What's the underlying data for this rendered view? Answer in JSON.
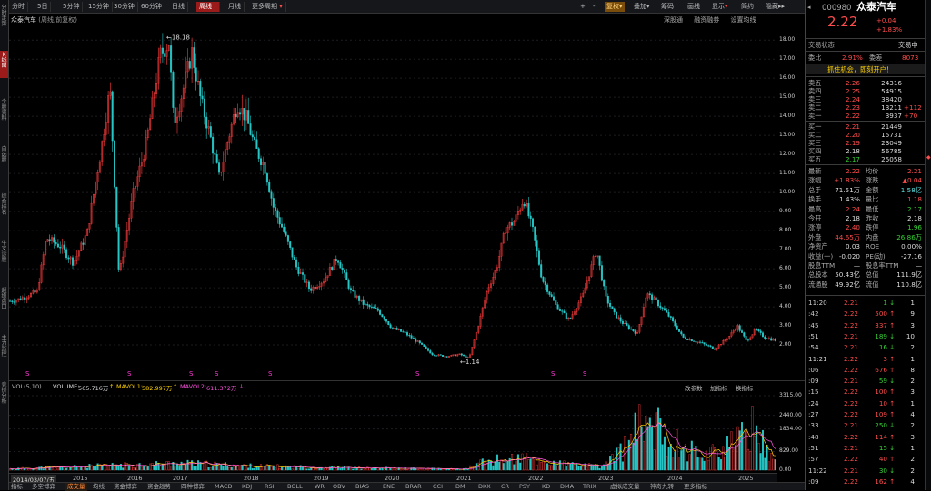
{
  "toolbar": {
    "periods": [
      "分时",
      "5日",
      "5分钟",
      "15分钟",
      "30分钟",
      "60分钟",
      "日线",
      "周线",
      "月线",
      "更多周期"
    ],
    "active_period": "周线",
    "right": [
      "+",
      "-",
      "复权",
      "叠加",
      "筹码",
      "画线",
      "显示",
      "简约",
      "隐藏"
    ]
  },
  "left_tabs": [
    "分时走势",
    "K线图",
    "个股资料",
    "自选股",
    "综合排名",
    "牛叉诊股",
    "超级盘口",
    "主力监控",
    "竞价分析"
  ],
  "chart_header": {
    "title": "众泰汽车",
    "subtitle": "(周线,前复权)",
    "links": [
      "深股通",
      "融资融券",
      "设置均线"
    ]
  },
  "chart_data": {
    "type": "candlestick",
    "price_axis": [
      "18.00",
      "17.00",
      "16.00",
      "15.00",
      "14.00",
      "13.00",
      "12.00",
      "11.00",
      "10.00",
      "9.00",
      "8.00",
      "7.00",
      "6.00",
      "5.00",
      "4.00",
      "3.00",
      "2.00"
    ],
    "high_label": "18.18",
    "low_label": "1.14",
    "years": [
      "2015",
      "2016",
      "2017",
      "2018",
      "2019",
      "2020",
      "2021",
      "2022",
      "2023",
      "2024",
      "2025"
    ],
    "cursor_date": "2014/03/07/五",
    "volume_axis": [
      "3315.00",
      "2440.00",
      "1834.00",
      "829.00",
      "0.00"
    ],
    "volume_unit": "万",
    "markers": [
      "S",
      "S",
      "S",
      "S",
      "S",
      "S",
      "S",
      "S"
    ],
    "series_anchor_price": [
      [
        0,
        4.3
      ],
      [
        10,
        4.4
      ],
      [
        20,
        4.6
      ],
      [
        30,
        4.8
      ],
      [
        40,
        7.6
      ],
      [
        55,
        7.2
      ],
      [
        70,
        6.3
      ],
      [
        85,
        7.9
      ],
      [
        100,
        12.2
      ],
      [
        110,
        15.5
      ],
      [
        120,
        5.6
      ],
      [
        135,
        9.8
      ],
      [
        150,
        12.6
      ],
      [
        165,
        17.2
      ],
      [
        175,
        17.9
      ],
      [
        180,
        13.6
      ],
      [
        190,
        15.3
      ],
      [
        200,
        17.4
      ],
      [
        210,
        14.8
      ],
      [
        220,
        13.0
      ],
      [
        230,
        10.8
      ],
      [
        240,
        12.8
      ],
      [
        250,
        14.7
      ],
      [
        260,
        13.9
      ],
      [
        270,
        12.3
      ],
      [
        280,
        11.4
      ],
      [
        290,
        9.2
      ],
      [
        300,
        8.1
      ],
      [
        315,
        6.1
      ],
      [
        330,
        4.9
      ],
      [
        345,
        5.4
      ],
      [
        360,
        6.6
      ],
      [
        375,
        4.8
      ],
      [
        390,
        4.1
      ],
      [
        405,
        3.8
      ],
      [
        420,
        2.9
      ],
      [
        435,
        2.6
      ],
      [
        450,
        2.1
      ],
      [
        465,
        1.5
      ],
      [
        480,
        1.4
      ],
      [
        495,
        1.5
      ],
      [
        505,
        1.3
      ],
      [
        515,
        3.0
      ],
      [
        525,
        4.9
      ],
      [
        535,
        6.0
      ],
      [
        545,
        8.1
      ],
      [
        555,
        8.5
      ],
      [
        565,
        9.7
      ],
      [
        575,
        8.0
      ],
      [
        585,
        5.5
      ],
      [
        600,
        4.1
      ],
      [
        615,
        3.3
      ],
      [
        630,
        4.6
      ],
      [
        645,
        7.0
      ],
      [
        655,
        4.5
      ],
      [
        665,
        3.6
      ],
      [
        675,
        3.1
      ],
      [
        690,
        2.6
      ],
      [
        700,
        4.7
      ],
      [
        710,
        4.3
      ],
      [
        725,
        3.5
      ],
      [
        740,
        2.4
      ],
      [
        760,
        2.1
      ],
      [
        775,
        1.8
      ],
      [
        790,
        2.4
      ],
      [
        800,
        3.0
      ],
      [
        810,
        2.2
      ],
      [
        820,
        2.8
      ],
      [
        830,
        2.4
      ],
      [
        845,
        2.2
      ]
    ]
  },
  "indicator": {
    "name": "VOL(5,10)",
    "volume_label": "VOLUME:",
    "volume_value": "565.716万",
    "ma1_label": "MAVOL1:",
    "ma1_value": "582.997万",
    "ma2_label": "MAVOL2:",
    "ma2_value": "611.372万",
    "links": [
      "改参数",
      "加指标",
      "换指标"
    ]
  },
  "bottom_tabs": [
    "指标",
    "多空博弈",
    "成交量",
    "均线",
    "资金博弈",
    "资金趋势",
    "四种博弈",
    "MACD",
    "KDJ",
    "RSI",
    "BOLL",
    "WR",
    "OBV",
    "BIAS",
    "ENE",
    "BRAR",
    "CCI",
    "DMI",
    "DKX",
    "CR",
    "PSY",
    "KD",
    "DMA",
    "TRIX",
    "虚拟成交量",
    "神奇九转",
    "更多指标"
  ],
  "active_bottom_tab": "成交量",
  "quote": {
    "code": "000980",
    "name": "众泰汽车",
    "price": "2.22",
    "change": "+0.04",
    "change_pct": "+1.83%",
    "status_label": "交易状态",
    "status_value": "交易中",
    "weibi_label": "委比",
    "weibi_value": "2.91%",
    "weicha_label": "委差",
    "weicha_value": "8073",
    "ad": "抓住机会，即刻开户！",
    "asks": [
      {
        "label": "卖五",
        "price": "2.26",
        "vol": "24316",
        "chg": ""
      },
      {
        "label": "卖四",
        "price": "2.25",
        "vol": "54915",
        "chg": ""
      },
      {
        "label": "卖三",
        "price": "2.24",
        "vol": "38420",
        "chg": ""
      },
      {
        "label": "卖二",
        "price": "2.23",
        "vol": "13211",
        "chg": "+112"
      },
      {
        "label": "卖一",
        "price": "2.22",
        "vol": "3937",
        "chg": "+70"
      }
    ],
    "bids": [
      {
        "label": "买一",
        "price": "2.21",
        "vol": "21449"
      },
      {
        "label": "买二",
        "price": "2.20",
        "vol": "15731"
      },
      {
        "label": "买三",
        "price": "2.19",
        "vol": "23049"
      },
      {
        "label": "买四",
        "price": "2.18",
        "vol": "56785"
      },
      {
        "label": "买五",
        "price": "2.17",
        "vol": "25058"
      }
    ],
    "stats": [
      {
        "l1": "最新",
        "v1": "2.22",
        "c1": "red",
        "l2": "均价",
        "v2": "2.21",
        "c2": "red"
      },
      {
        "l1": "涨幅",
        "v1": "+1.83%",
        "c1": "red",
        "l2": "涨跌",
        "v2": "▲0.04",
        "c2": "red"
      },
      {
        "l1": "总手",
        "v1": "71.51万",
        "c1": "white",
        "l2": "金额",
        "v2": "1.58亿",
        "c2": "cyan"
      },
      {
        "l1": "换手",
        "v1": "1.43%",
        "c1": "white",
        "l2": "量比",
        "v2": "1.18",
        "c2": "red"
      },
      {
        "l1": "最高",
        "v1": "2.24",
        "c1": "red",
        "l2": "最低",
        "v2": "2.17",
        "c2": "green"
      },
      {
        "l1": "今开",
        "v1": "2.18",
        "c1": "white",
        "l2": "昨收",
        "v2": "2.18",
        "c2": "white"
      },
      {
        "l1": "涨停",
        "v1": "2.40",
        "c1": "red",
        "l2": "跌停",
        "v2": "1.96",
        "c2": "green"
      },
      {
        "l1": "外盘",
        "v1": "44.65万",
        "c1": "red",
        "l2": "内盘",
        "v2": "26.86万",
        "c2": "green"
      },
      {
        "l1": "净资产",
        "v1": "0.03",
        "c1": "white",
        "l2": "ROE",
        "v2": "0.00%",
        "c2": "white"
      },
      {
        "l1": "收益(一)",
        "v1": "-0.020",
        "c1": "white",
        "l2": "PE(动)",
        "v2": "-27.16",
        "c2": "white"
      },
      {
        "l1": "股息TTM",
        "v1": "—",
        "c1": "white",
        "l2": "股息率TTM",
        "v2": "—",
        "c2": "white"
      },
      {
        "l1": "总股本",
        "v1": "50.43亿",
        "c1": "white",
        "l2": "总值",
        "v2": "111.9亿",
        "c2": "white"
      },
      {
        "l1": "流通股",
        "v1": "49.92亿",
        "c1": "white",
        "l2": "流值",
        "v2": "110.8亿",
        "c2": "white"
      }
    ],
    "ticks": [
      {
        "t": "11:20",
        "p": "2.21",
        "v": "1",
        "n": "1"
      },
      {
        "t": ":42",
        "p": "2.22",
        "v": "500",
        "n": "9"
      },
      {
        "t": ":45",
        "p": "2.22",
        "v": "337",
        "n": "3"
      },
      {
        "t": ":51",
        "p": "2.21",
        "v": "189",
        "n": "10"
      },
      {
        "t": ":54",
        "p": "2.21",
        "v": "16",
        "n": "2"
      },
      {
        "t": "11:21",
        "p": "2.22",
        "v": "3",
        "n": "1"
      },
      {
        "t": ":06",
        "p": "2.22",
        "v": "676",
        "n": "8"
      },
      {
        "t": ":09",
        "p": "2.21",
        "v": "59",
        "n": "2"
      },
      {
        "t": ":15",
        "p": "2.22",
        "v": "100",
        "n": "3"
      },
      {
        "t": ":24",
        "p": "2.22",
        "v": "10",
        "n": "1"
      },
      {
        "t": ":27",
        "p": "2.22",
        "v": "109",
        "n": "4"
      },
      {
        "t": ":33",
        "p": "2.21",
        "v": "250",
        "n": "2"
      },
      {
        "t": ":48",
        "p": "2.22",
        "v": "114",
        "n": "3"
      },
      {
        "t": ":51",
        "p": "2.21",
        "v": "15",
        "n": "1"
      },
      {
        "t": ":57",
        "p": "2.22",
        "v": "40",
        "n": "2"
      },
      {
        "t": "11:22",
        "p": "2.21",
        "v": "30",
        "n": "2"
      },
      {
        "t": ":09",
        "p": "2.22",
        "v": "162",
        "n": "4"
      }
    ]
  }
}
